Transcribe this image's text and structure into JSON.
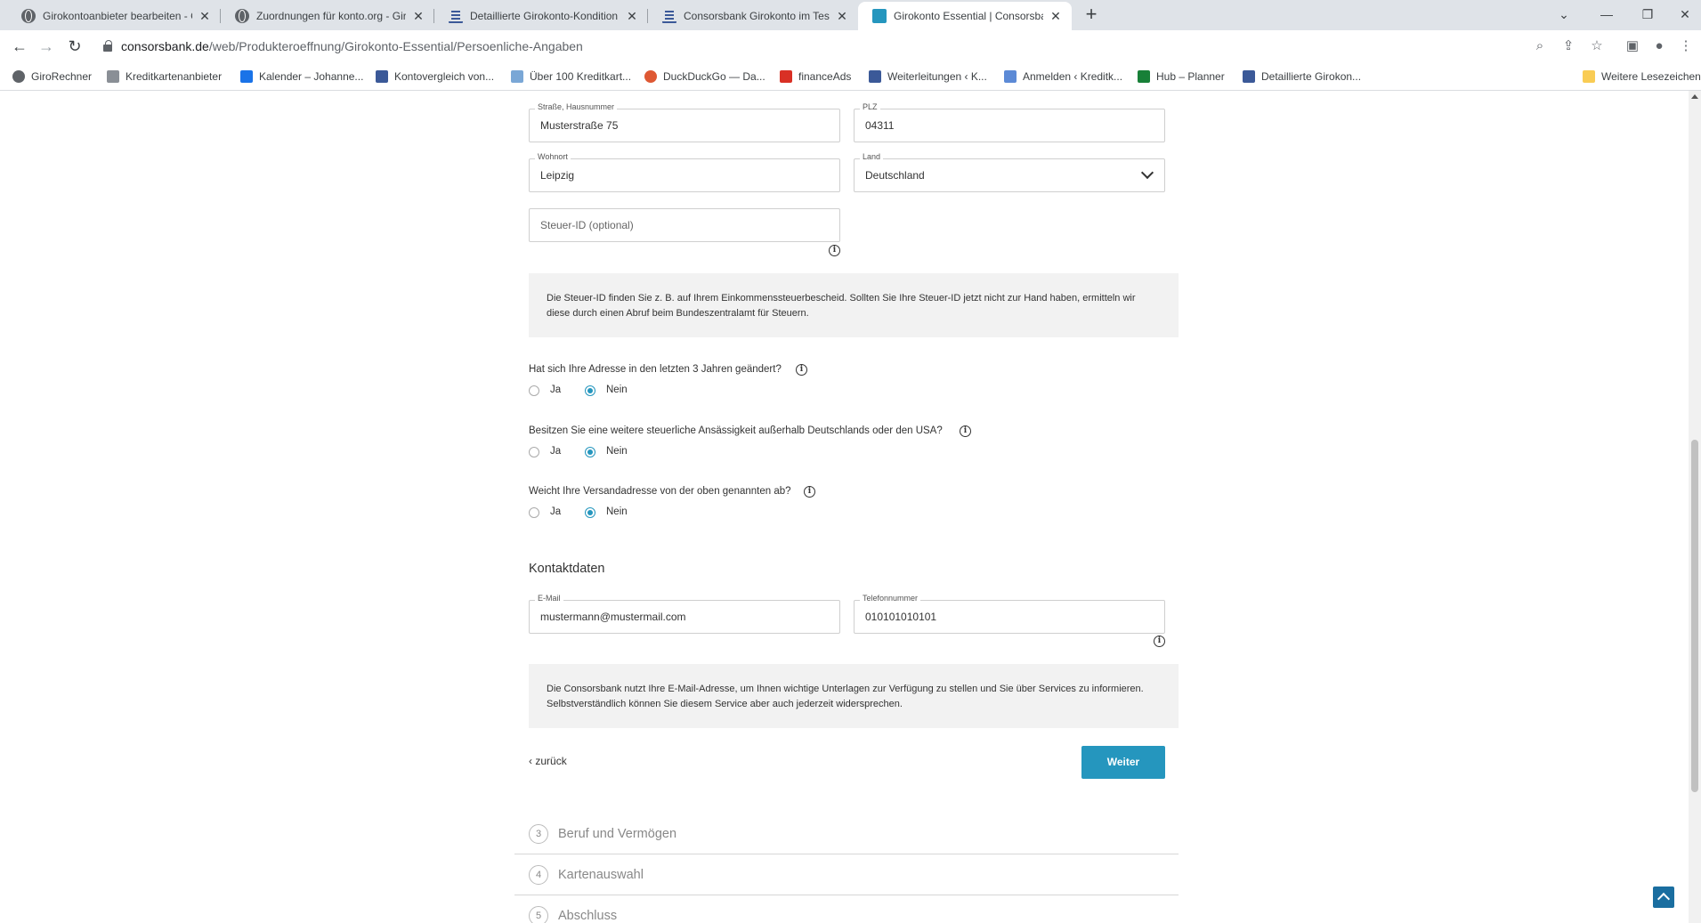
{
  "browser": {
    "tabs": [
      {
        "title": "Girokontoanbieter bearbeiten - G",
        "icon": "globe-icon"
      },
      {
        "title": "Zuordnungen für konto.org - Giro",
        "icon": "globe-icon"
      },
      {
        "title": "Detaillierte Girokonto-Kondition",
        "icon": "document-icon"
      },
      {
        "title": "Consorsbank Girokonto im Test |",
        "icon": "document-icon"
      },
      {
        "title": "Girokonto Essential | Consorsban",
        "icon": "consorsbank-icon"
      }
    ],
    "url_host": "consorsbank.de",
    "url_path": "/web/Produkteroeffnung/Girokonto-Essential/Persoenliche-Angaben",
    "bookmarks": [
      {
        "label": "GiroRechner",
        "color": "#5f6368"
      },
      {
        "label": "Kreditkartenanbieter",
        "color": "#8a8f96"
      },
      {
        "label": "Kalender – Johanne...",
        "color": "#1a73e8"
      },
      {
        "label": "Kontovergleich von...",
        "color": "#3b5998"
      },
      {
        "label": "Über 100 Kreditkart...",
        "color": "#7aa7d6"
      },
      {
        "label": "DuckDuckGo — Da...",
        "color": "#de5833"
      },
      {
        "label": "financeAds",
        "color": "#d93025"
      },
      {
        "label": "Weiterleitungen ‹ K...",
        "color": "#3b5998"
      },
      {
        "label": "Anmelden ‹ Kreditk...",
        "color": "#5c8ad6"
      },
      {
        "label": "Hub – Planner",
        "color": "#188038"
      },
      {
        "label": "Detaillierte Girokon...",
        "color": "#3b5998"
      }
    ],
    "other_bookmarks": "Weitere Lesezeichen"
  },
  "form": {
    "street": {
      "label": "Straße, Hausnummer",
      "value": "Musterstraße 75"
    },
    "zip": {
      "label": "PLZ",
      "value": "04311"
    },
    "city": {
      "label": "Wohnort",
      "value": "Leipzig"
    },
    "country": {
      "label": "Land",
      "value": "Deutschland"
    },
    "tax_id": {
      "placeholder": "Steuer-ID (optional)"
    },
    "tax_note": "Die Steuer-ID finden Sie z. B. auf Ihrem Einkommenssteuerbescheid. Sollten Sie Ihre Steuer-ID jetzt nicht zur Hand haben, ermitteln wir diese durch einen Abruf beim Bundeszentralamt für Steuern.",
    "questions": [
      {
        "text": "Hat sich Ihre Adresse in den letzten 3 Jahren geändert?",
        "yes": "Ja",
        "no": "Nein",
        "selected": "Nein"
      },
      {
        "text": "Besitzen Sie eine weitere steuerliche Ansässigkeit außerhalb Deutschlands oder den USA?",
        "yes": "Ja",
        "no": "Nein",
        "selected": "Nein"
      },
      {
        "text": "Weicht Ihre Versandadresse von der oben genannten ab?",
        "yes": "Ja",
        "no": "Nein",
        "selected": "Nein"
      }
    ],
    "contact_title": "Kontaktdaten",
    "email": {
      "label": "E-Mail",
      "value": "mustermann@mustermail.com"
    },
    "phone": {
      "label": "Telefonnummer",
      "value": "010101010101"
    },
    "email_note": "Die Consorsbank nutzt Ihre E-Mail-Adresse, um Ihnen wichtige Unterlagen zur Verfügung zu stellen und Sie über Services zu informieren. Selbstverständlich können Sie diesem Service aber auch jederzeit widersprechen.",
    "back_label": "zurück",
    "next_label": "Weiter"
  },
  "steps": [
    {
      "num": "3",
      "label": "Beruf und Vermögen"
    },
    {
      "num": "4",
      "label": "Kartenauswahl"
    },
    {
      "num": "5",
      "label": "Abschluss"
    }
  ],
  "colors": {
    "accent": "#2596be",
    "note_bg": "#f2f2f2"
  }
}
